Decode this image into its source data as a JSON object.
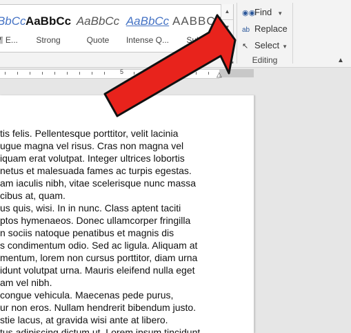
{
  "styles_gallery": {
    "items": [
      {
        "sample": "aBbCc",
        "label": "¶ E..."
      },
      {
        "sample": "AaBbCc",
        "label": "Strong"
      },
      {
        "sample": "AaBbCc",
        "label": "Quote"
      },
      {
        "sample": "AaBbCc",
        "label": "Intense Q..."
      },
      {
        "sample": "AABBCC",
        "label": "Sub..."
      }
    ]
  },
  "editing": {
    "find_label": "Find",
    "replace_label": "Replace",
    "select_label": "Select",
    "group_label": "Editing"
  },
  "ruler": {
    "mark_5": "5",
    "mark_6": "6"
  },
  "document": {
    "lines": [
      "tis felis. Pellentesque porttitor, velit lacinia",
      "ugue magna vel risus. Cras non magna vel",
      "iquam erat volutpat. Integer ultrices lobortis",
      "netus et malesuada fames ac turpis egestas.",
      "am iaculis nibh, vitae scelerisque nunc massa",
      "cibus at, quam.",
      "us quis, wisi. In in nunc. Class aptent taciti",
      "ptos hymenaeos. Donec ullamcorper fringilla",
      "n sociis natoque penatibus et magnis dis",
      "s condimentum odio. Sed ac ligula. Aliquam at",
      "mentum, lorem non cursus porttitor, diam urna",
      "idunt volutpat urna. Mauris eleifend nulla eget",
      "am vel nibh.",
      "congue vehicula. Maecenas pede purus,",
      "ur non eros. Nullam hendrerit bibendum justo.",
      "stie lacus, at gravida wisi ante at libero.",
      "tus adipiscing dictum ut. Lorem ipsum tincidunt..."
    ]
  },
  "colors": {
    "arrow_fill": "#e8231c",
    "arrow_stroke": "#111111"
  }
}
